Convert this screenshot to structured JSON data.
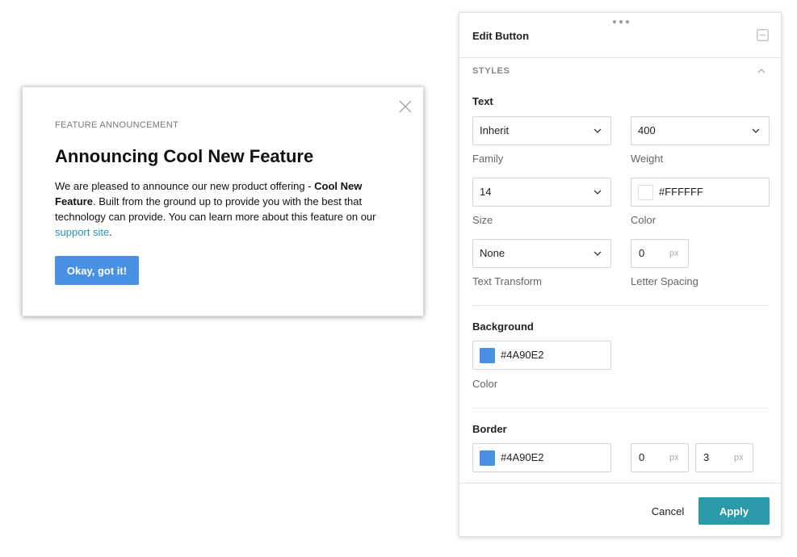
{
  "modal": {
    "eyebrow": "FEATURE ANNOUNCEMENT",
    "title": "Announcing Cool New Feature",
    "body_intro": "We are pleased to announce our new product offering - ",
    "body_bold": "Cool New Feature",
    "body_middle": ". Built from the ground up to provide you with the best that technology can provide. You can learn more about this feature on our ",
    "body_link": "support site",
    "body_end": ".",
    "button_label": "Okay, got it!",
    "close_icon": "close-icon"
  },
  "panel": {
    "title": "Edit Button",
    "minimize_icon": "minimize-icon",
    "section_label": "STYLES",
    "text_group": {
      "title": "Text",
      "family": {
        "value": "Inherit",
        "label": "Family"
      },
      "weight": {
        "value": "400",
        "label": "Weight"
      },
      "size": {
        "value": "14",
        "label": "Size"
      },
      "color": {
        "value": "#FFFFFF",
        "label": "Color",
        "swatch": "#FFFFFF"
      },
      "transform": {
        "value": "None",
        "label": "Text Transform"
      },
      "letter_spacing": {
        "value": "0",
        "unit": "px",
        "label": "Letter Spacing"
      }
    },
    "background_group": {
      "title": "Background",
      "color": {
        "value": "#4A90E2",
        "label": "Color",
        "swatch": "#4A90E2"
      }
    },
    "border_group": {
      "title": "Border",
      "color": {
        "value": "#4A90E2",
        "swatch": "#4A90E2"
      },
      "width": {
        "value": "0",
        "unit": "px"
      },
      "radius": {
        "value": "3",
        "unit": "px"
      }
    },
    "cancel_label": "Cancel",
    "apply_label": "Apply"
  },
  "colors": {
    "accent_blue": "#4A90E2",
    "apply_teal": "#2A9AA8",
    "link": "#2A93B5"
  }
}
